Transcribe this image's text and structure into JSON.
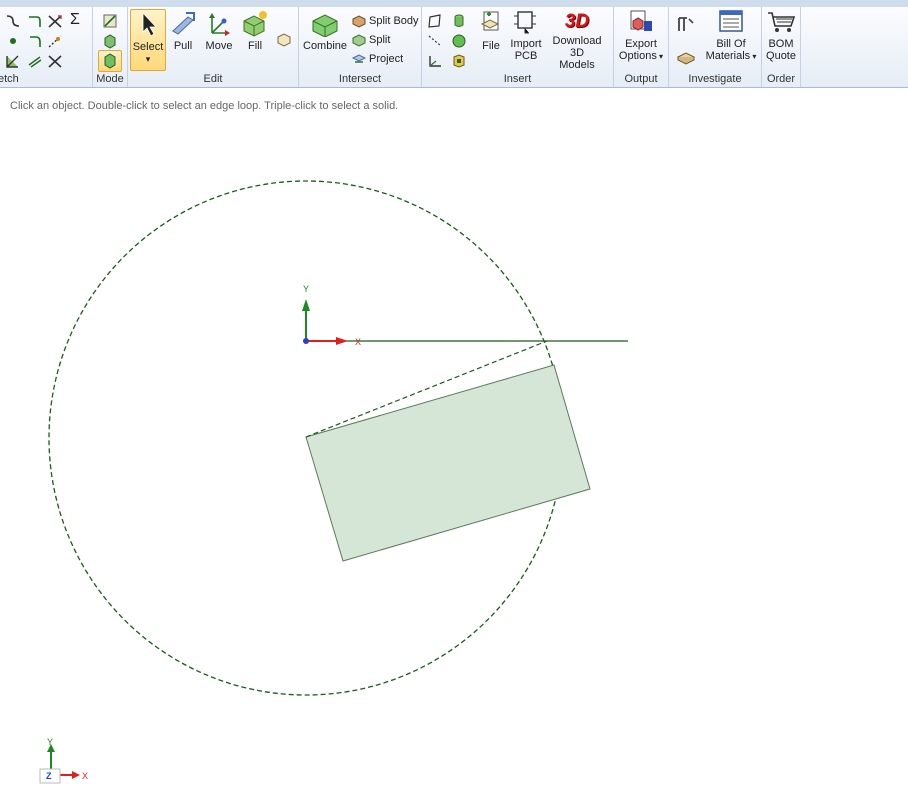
{
  "ribbon": {
    "groups": {
      "sketch": "etch",
      "mode": "Mode",
      "edit": "Edit",
      "intersect": "Intersect",
      "insert": "Insert",
      "output": "Output",
      "investigate": "Investigate",
      "order": "Order"
    },
    "sketch_sigma": "Σ",
    "edit": {
      "select": "Select",
      "select_arrow": "▾",
      "pull": "Pull",
      "move": "Move",
      "fill": "Fill"
    },
    "intersect": {
      "combine": "Combine",
      "split_body": "Split Body",
      "split": "Split",
      "project": "Project"
    },
    "insert": {
      "file": "File",
      "import_pcb_1": "Import",
      "import_pcb_2": "PCB",
      "download_1": "Download 3D",
      "download_2": "Models",
      "download_badge": "3D"
    },
    "output": {
      "export_1": "Export",
      "export_2": "Options"
    },
    "investigate": {
      "bom_1": "Bill Of",
      "bom_2": "Materials"
    },
    "order": {
      "quote_1": "BOM",
      "quote_2": "Quote"
    }
  },
  "status_text": "Click an object. Double-click to select an edge loop. Triple-click to select a solid.",
  "axes": {
    "x": "X",
    "y": "Y",
    "z": "Z"
  },
  "colors": {
    "sketch_line": "#1d5a1d",
    "axis_x": "#e02020",
    "axis_y": "#1c8a1c",
    "axis_z": "#2a3fd0",
    "face_fill": "#d6e6d6"
  }
}
